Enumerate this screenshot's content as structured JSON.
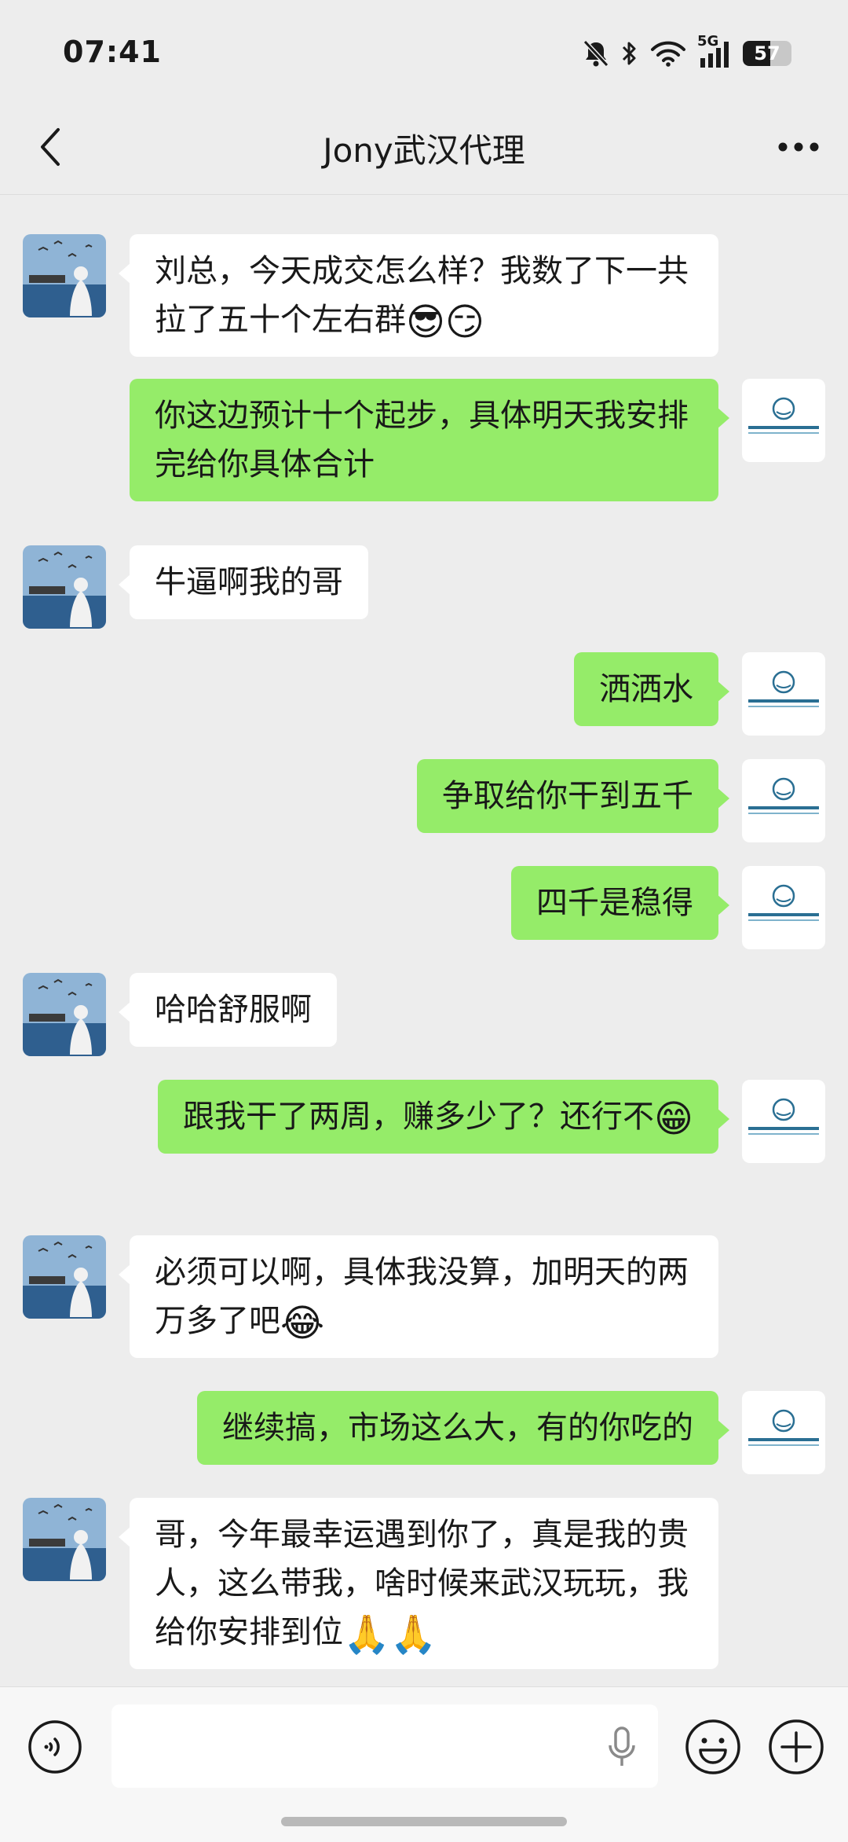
{
  "status_bar": {
    "time": "07:41",
    "network": "5G",
    "battery": "57",
    "battery_level_percent": 57,
    "icons": [
      "bell-muted-icon",
      "bluetooth-icon",
      "wifi-icon",
      "cellular-signal-icon",
      "battery-icon"
    ]
  },
  "header": {
    "title": "Jony武汉代理",
    "back_icon": "chevron-left-icon",
    "more_icon": "more-dots-icon"
  },
  "messages": [
    {
      "side": "recv",
      "text": "刘总，今天成交怎么样？我数了下一共拉了五十个左右群",
      "emoji": "😎😏"
    },
    {
      "side": "sent",
      "text": "你这边预计十个起步，具体明天我安排完给你具体合计",
      "emoji": ""
    },
    {
      "side": "recv",
      "text": "牛逼啊我的哥",
      "emoji": ""
    },
    {
      "side": "sent",
      "text": "洒洒水",
      "emoji": ""
    },
    {
      "side": "sent",
      "text": "争取给你干到五千",
      "emoji": ""
    },
    {
      "side": "sent",
      "text": "四千是稳得",
      "emoji": ""
    },
    {
      "side": "recv",
      "text": "哈哈舒服啊",
      "emoji": ""
    },
    {
      "side": "sent",
      "text": "跟我干了两周，赚多少了？还行不",
      "emoji": "😁"
    },
    {
      "side": "recv",
      "text": "必须可以啊，具体我没算，加明天的两万多了吧",
      "emoji": "😂"
    },
    {
      "side": "sent",
      "text": "继续搞，市场这么大，有的你吃的",
      "emoji": ""
    },
    {
      "side": "recv",
      "text": "哥，今年最幸运遇到你了，真是我的贵人，这么带我，啥时候来武汉玩玩，我给你安排到位",
      "emoji": "🙏🙏"
    }
  ],
  "input_bar": {
    "placeholder": "",
    "icons": [
      "voice-toggle-icon",
      "microphone-icon",
      "emoji-icon",
      "plus-icon"
    ]
  },
  "colors": {
    "background": "#ededed",
    "sent_bubble": "#95ec69",
    "recv_bubble": "#ffffff"
  }
}
